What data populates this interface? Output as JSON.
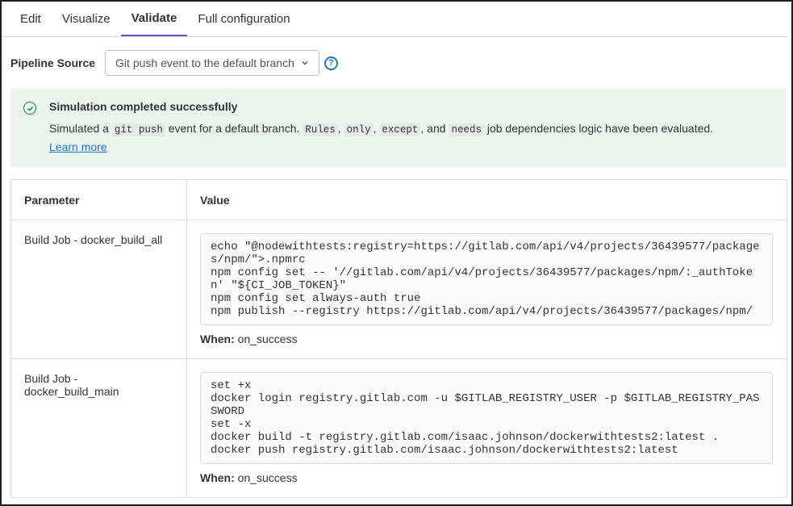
{
  "tabs": [
    "Edit",
    "Visualize",
    "Validate",
    "Full configuration"
  ],
  "active_tab": "Validate",
  "pipeline_source": {
    "label": "Pipeline Source",
    "selected": "Git push event to the default branch"
  },
  "alert": {
    "title": "Simulation completed successfully",
    "text_1": "Simulated a",
    "code_1": "git push",
    "text_2": "event for a default branch.",
    "code_2": "Rules",
    "sep_1": ",",
    "code_3": "only",
    "sep_2": ",",
    "code_4": "except",
    "text_3": ", and",
    "code_5": "needs",
    "text_4": "job dependencies logic have been evaluated.",
    "learn_more": "Learn more"
  },
  "table": {
    "headers": {
      "parameter": "Parameter",
      "value": "Value"
    },
    "rows": [
      {
        "parameter": "Build Job - docker_build_all",
        "script": "echo \"@nodewithtests:registry=https://gitlab.com/api/v4/projects/36439577/packages/npm/\">.npmrc\nnpm config set -- '//gitlab.com/api/v4/projects/36439577/packages/npm/:_authToken' \"${CI_JOB_TOKEN}\"\nnpm config set always-auth true\nnpm publish --registry https://gitlab.com/api/v4/projects/36439577/packages/npm/",
        "when_label": "When:",
        "when_value": "on_success"
      },
      {
        "parameter": "Build Job - docker_build_main",
        "script": "set +x\ndocker login registry.gitlab.com -u $GITLAB_REGISTRY_USER -p $GITLAB_REGISTRY_PASSWORD\nset -x\ndocker build -t registry.gitlab.com/isaac.johnson/dockerwithtests2:latest .\ndocker push registry.gitlab.com/isaac.johnson/dockerwithtests2:latest",
        "when_label": "When:",
        "when_value": "on_success"
      }
    ]
  },
  "colors": {
    "accent": "#6e49cb",
    "link": "#1f75cb",
    "success": "#108548",
    "alert_bg": "#ecf4ee"
  }
}
